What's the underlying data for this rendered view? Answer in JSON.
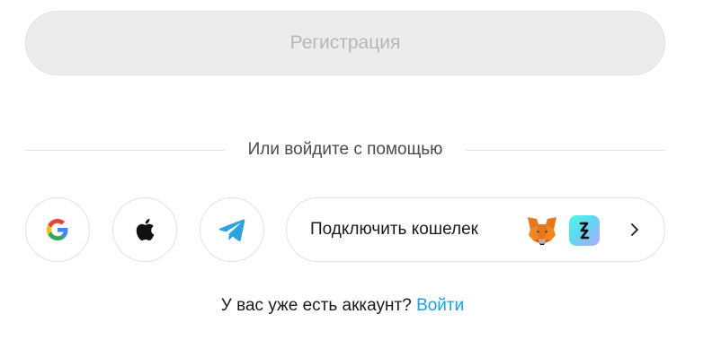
{
  "register": {
    "label": "Регистрация"
  },
  "divider": {
    "text": "Или войдите с помощью"
  },
  "social": {
    "google_icon": "google-logo",
    "apple_icon": "apple-logo",
    "telegram_icon": "telegram-paper-plane"
  },
  "wallet": {
    "label": "Подключить кошелек",
    "icons": [
      "metamask-fox",
      "bitget-wallet"
    ],
    "chevron_icon": "chevron-right"
  },
  "footer": {
    "question": "У вас уже есть аккаунт?",
    "login_link": "Войти"
  },
  "colors": {
    "register_bg": "#ececec",
    "register_text": "#b6b6b6",
    "link": "#1aa3e0",
    "telegram": "#2aa3df",
    "border": "#e2e2e2"
  }
}
